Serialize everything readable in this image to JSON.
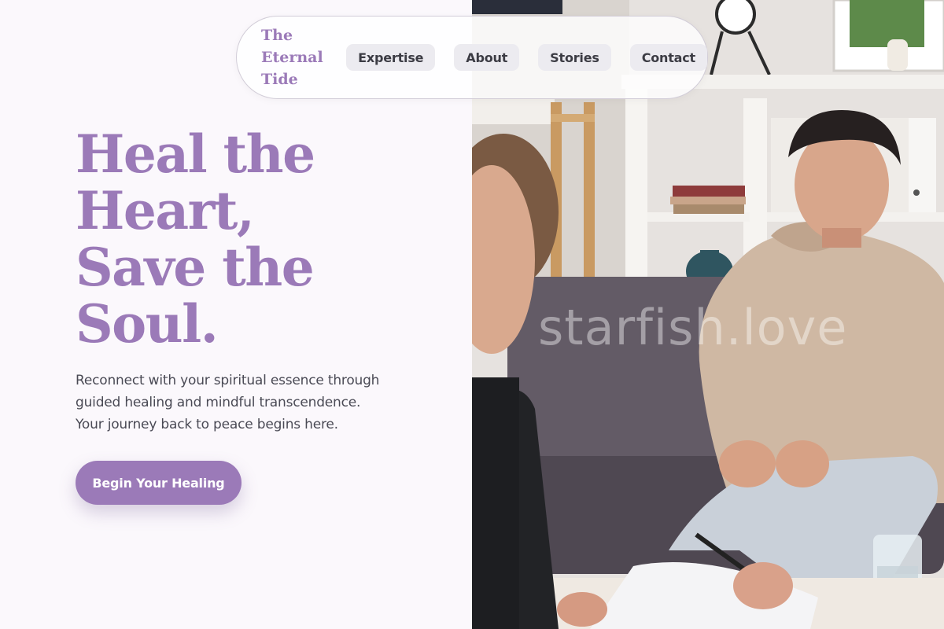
{
  "brand": {
    "name_lines": [
      "The",
      "Eternal",
      "Tide"
    ],
    "color": "#9b7ab8"
  },
  "nav": {
    "items": [
      {
        "label": "Expertise"
      },
      {
        "label": "About"
      },
      {
        "label": "Stories"
      },
      {
        "label": "Contact"
      }
    ]
  },
  "hero": {
    "title_lines": [
      "Heal the",
      "Heart,",
      "Save the",
      "Soul."
    ],
    "subtitle_lines": [
      "Reconnect with your spiritual essence through",
      "guided healing and mindful transcendence.",
      "Your journey back to peace begins here."
    ],
    "cta_label": "Begin Your Healing"
  },
  "image": {
    "watermark": "starfish.love",
    "subject": "therapy-session-photo"
  },
  "colors": {
    "accent": "#9b7ab8",
    "background": "#fbf8fc",
    "text": "#4a4a55",
    "nav_pill": "#ecebf0"
  }
}
